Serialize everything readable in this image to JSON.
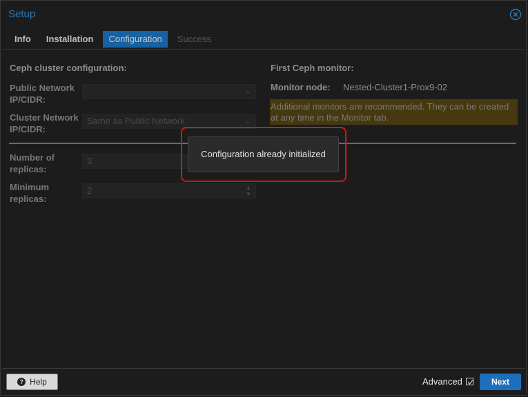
{
  "window": {
    "title": "Setup"
  },
  "tabs": [
    {
      "label": "Info",
      "state": "normal"
    },
    {
      "label": "Installation",
      "state": "normal"
    },
    {
      "label": "Configuration",
      "state": "active"
    },
    {
      "label": "Success",
      "state": "disabled"
    }
  ],
  "left": {
    "heading": "Ceph cluster configuration:",
    "public_network": {
      "label_1": "Public Network",
      "label_2": "IP/CIDR:",
      "value": ""
    },
    "cluster_network": {
      "label_1": "Cluster Network",
      "label_2": "IP/CIDR:",
      "value": "Same as Public Network"
    },
    "replicas": {
      "label_1": "Number of",
      "label_2": "replicas:",
      "value": "3"
    },
    "min_replicas": {
      "label_1": "Minimum",
      "label_2": "replicas:",
      "value": "2"
    }
  },
  "right": {
    "heading": "First Ceph monitor:",
    "monitor_label": "Monitor node:",
    "monitor_value": "Nested-Cluster1-Prox9-02",
    "warning_line_1": "Additional monitors are recommended. They can be created",
    "warning_line_2": "at any time in the Monitor tab."
  },
  "toast": {
    "message": "Configuration already initialized"
  },
  "footer": {
    "help_label": "Help",
    "advanced_label": "Advanced",
    "advanced_checked": true,
    "next_label": "Next"
  },
  "colors": {
    "accent": "#1d7ed1",
    "highlight": "#e01010",
    "warning_bg": "#5c4a14"
  },
  "icons": [
    "close-icon",
    "help-icon",
    "checkbox-check-icon",
    "chevron-down-icon",
    "spinner-icon"
  ]
}
